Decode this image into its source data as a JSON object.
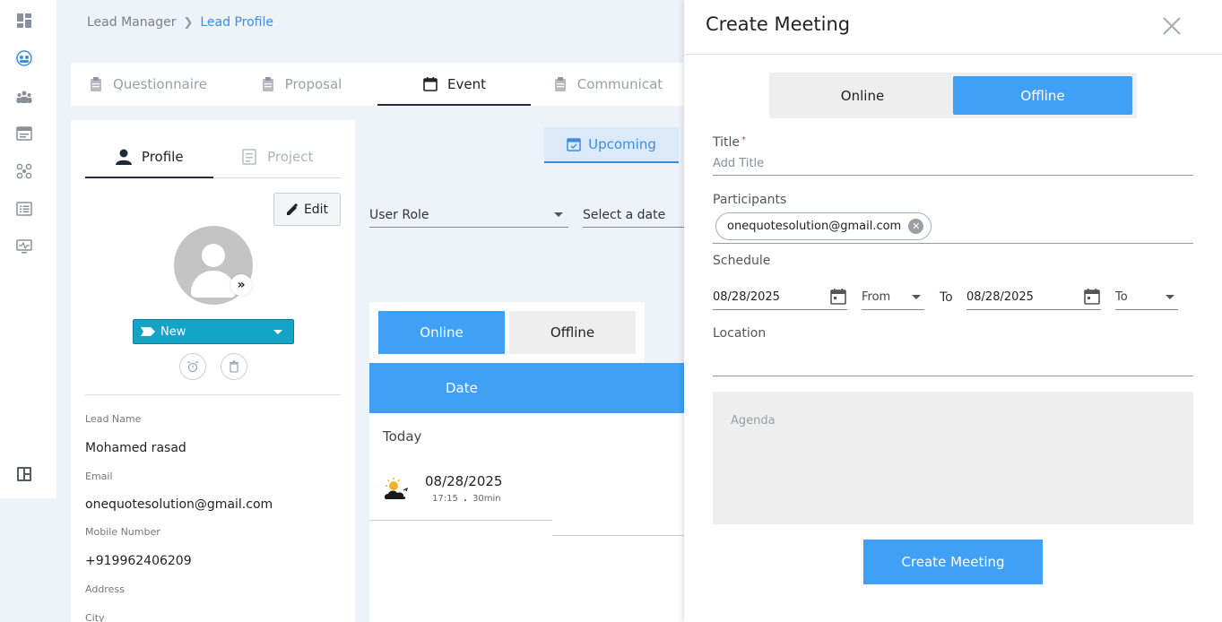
{
  "breadcrumb": {
    "parent": "Lead Manager",
    "current": "Lead Profile"
  },
  "tabs": [
    {
      "label": "Questionnaire",
      "icon": "clipboard-icon"
    },
    {
      "label": "Proposal",
      "icon": "clipboard-icon"
    },
    {
      "label": "Event",
      "icon": "calendar-icon",
      "active": true
    },
    {
      "label": "Communicat",
      "icon": "clipboard-icon"
    }
  ],
  "profile": {
    "tabs": [
      {
        "label": "Profile",
        "icon": "person-icon",
        "active": true
      },
      {
        "label": "Project",
        "icon": "project-icon"
      }
    ],
    "edit_label": "Edit",
    "status": "New",
    "fields": [
      {
        "label": "Lead Name",
        "value": "Mohamed rasad"
      },
      {
        "label": "Email",
        "value": "onequotesolution@gmail.com"
      },
      {
        "label": "Mobile Number",
        "value": "+919962406209"
      },
      {
        "label": "Address",
        "value": ""
      },
      {
        "label": "City",
        "value": ""
      }
    ]
  },
  "events": {
    "upcoming_label": "Upcoming",
    "user_role_label": "User Role",
    "date_label": "Select a date",
    "toggle": {
      "online": "Online",
      "offline": "Offline"
    },
    "table_header": "Date",
    "group": "Today",
    "item": {
      "date": "08/28/2025",
      "time": "17:15",
      "dot": ".",
      "duration": "30min"
    }
  },
  "drawer": {
    "title": "Create Meeting",
    "mode": {
      "online": "Online",
      "offline": "Offline",
      "selected": "Offline"
    },
    "title_label": "Title",
    "required_mark": "*",
    "title_placeholder": "Add Title",
    "participants_label": "Participants",
    "participant_chip": "onequotesolution@gmail.com",
    "schedule_label": "Schedule",
    "start_date": "08/28/2025",
    "from_label": "From",
    "to_label": "To",
    "end_date": "08/28/2025",
    "to_time_label": "To",
    "location_label": "Location",
    "agenda_placeholder": "Agenda",
    "create_label": "Create Meeting"
  },
  "colors": {
    "accent": "#3fa0f5",
    "status": "#14a4c6",
    "link": "#3a8ddf"
  }
}
